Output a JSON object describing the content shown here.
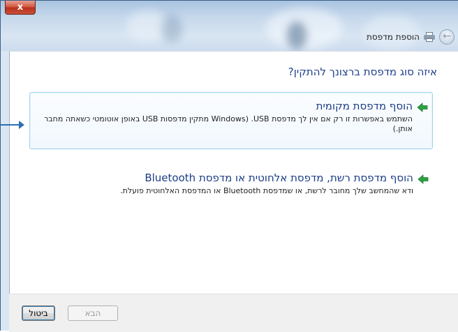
{
  "window": {
    "title": "הוספת מדפסת",
    "close_label": "x",
    "back_icon": "back-arrow-icon",
    "title_icon": "printer-icon"
  },
  "main": {
    "question": "איזה סוג מדפסת ברצונך להתקין?",
    "options": [
      {
        "title": "הוסף מדפסת מקומית",
        "description": "השתמש באפשרות זו רק אם אין לך מדפסת USB. (Windows מתקין מדפסות USB באופן אוטומטי כשאתה מחבר אותן.)",
        "icon": "green-arrow-icon",
        "selected": true
      },
      {
        "title": "הוסף מדפסת רשת, מדפסת אלחוטית או מדפסת Bluetooth",
        "description": "ודא שהמחשב שלך מחובר לרשת, או שמדפסת Bluetooth או המדפסת האלחוטית פועלת.",
        "icon": "green-arrow-icon",
        "selected": false
      }
    ]
  },
  "footer": {
    "next_label": "הבא",
    "cancel_label": "ביטול"
  },
  "colors": {
    "accent": "#1b3d86",
    "selection_border": "#9fd3ee",
    "arrow_green": "#2ea043"
  }
}
